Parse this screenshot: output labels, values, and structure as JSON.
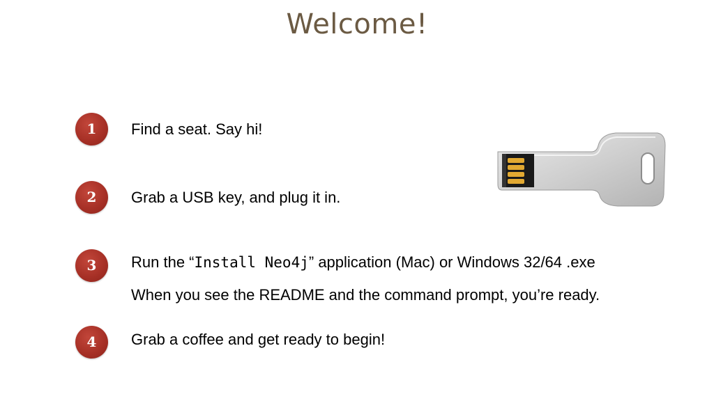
{
  "title": "Welcome!",
  "steps": [
    {
      "number": "1",
      "text": "Find a seat. Say hi!"
    },
    {
      "number": "2",
      "text": "Grab a USB key, and plug it in."
    },
    {
      "number": "3",
      "text_before": "Run the “",
      "code": "Install Neo4j",
      "text_after": "” application (Mac) or Windows 32/64 .exe",
      "text_line2": "When you see the README and the command prompt, you’re ready."
    },
    {
      "number": "4",
      "text": "Grab a coffee and get ready to begin!"
    }
  ],
  "image": {
    "icon": "usb-key-icon"
  },
  "colors": {
    "title": "#6b5a43",
    "badge": "#a52f25",
    "text": "#000000"
  }
}
